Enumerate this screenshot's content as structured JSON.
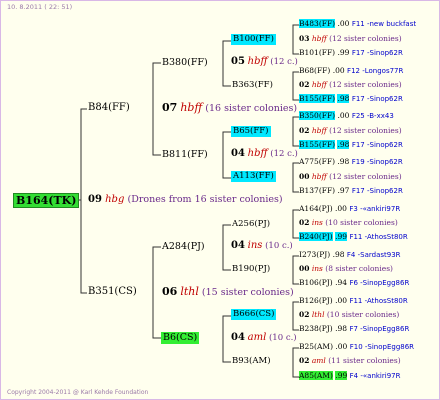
{
  "colors": {
    "root_bg": "#33dd33",
    "cyan_bg": "#00e8ff",
    "green_bg": "#33ee33",
    "red": "#c00000",
    "blue": "#0000cc"
  },
  "header": "10.  8.2011 ( 22: 51)",
  "footer": "Copyright 2004-2011 @ Karl Kehde Foundation",
  "g1": {
    "name": "B164(TK)"
  },
  "g2": [
    {
      "name": "B84(FF)",
      "year": "09",
      "code": "hbg",
      "note": "(Drones from 16 sister colonies)"
    },
    {
      "name": "B351(CS)"
    }
  ],
  "g3": [
    {
      "name": "B380(FF)",
      "year": "07",
      "code": "hbff",
      "note": "(16 sister colonies)"
    },
    {
      "name": "B811(FF)"
    },
    {
      "name": "A284(PJ)",
      "year": "06",
      "code": "lthl",
      "note": "(15 sister colonies)"
    },
    {
      "name": "B6(CS)"
    }
  ],
  "g4": [
    {
      "name": "B100(FF)",
      "year": "05",
      "code": "hbff",
      "note": "(12 c.)"
    },
    {
      "name": "B363(FF)"
    },
    {
      "name": "B65(FF)",
      "year": "04",
      "code": "hbff",
      "note": "(12 c.)"
    },
    {
      "name": "A113(FF)"
    },
    {
      "name": "A256(PJ)",
      "year": "04",
      "code": "ins",
      "note": "(10 c.)"
    },
    {
      "name": "B190(PJ)"
    },
    {
      "name": "B666(CS)",
      "year": "04",
      "code": "aml",
      "note": "(10 c.)"
    },
    {
      "name": "B93(AM)"
    }
  ],
  "g5": [
    {
      "name": "B483(FF)",
      "year": ".00",
      "right": "F11 -new buckfast"
    },
    {
      "name": "03",
      "code": "hbff",
      "note": "(12 sister colonies)"
    },
    {
      "name": "B101(FF)",
      "year": ".99",
      "right": "F17 -Sinop62R"
    },
    {
      "name": "B68(FF)",
      "year": ".00",
      "right": "F12 -Longos77R"
    },
    {
      "name": "02",
      "code": "hbff",
      "note": "(12 sister colonies)"
    },
    {
      "name": "B155(FF)",
      "year": ".98",
      "right": "F17 -Sinop62R"
    },
    {
      "name": "B350(FF)",
      "year": ".00",
      "right": "F25 -B-xx43"
    },
    {
      "name": "02",
      "code": "hbff",
      "note": "(12 sister colonies)"
    },
    {
      "name": "B155(FF)",
      "year": ".98",
      "right": "F17 -Sinop62R"
    },
    {
      "name": "A775(FF)",
      "year": ".98",
      "right": "F19 -Sinop62R"
    },
    {
      "name": "00",
      "code": "hbff",
      "note": "(12 sister colonies)"
    },
    {
      "name": "B137(FF)",
      "year": ".97",
      "right": "F17 -Sinop62R"
    },
    {
      "name": "A164(PJ)",
      "year": ".00",
      "right": "F3 -«ankiri97R"
    },
    {
      "name": "02",
      "code": "ins",
      "note": "(10 sister colonies)"
    },
    {
      "name": "B240(PJ)",
      "year": ".99",
      "right": "F11 -AthosSt80R"
    },
    {
      "name": "I273(PJ)",
      "year": ".98",
      "right": "F4 -Sardast93R"
    },
    {
      "name": "00",
      "code": "ins",
      "note": "(8 sister colonies)"
    },
    {
      "name": "B106(PJ)",
      "year": ".94",
      "right": "F6 -SinopEgg86R"
    },
    {
      "name": "B126(PJ)",
      "year": ".00",
      "right": "F11 -AthosSt80R"
    },
    {
      "name": "02",
      "code": "lthl",
      "note": "(10 sister colonies)"
    },
    {
      "name": "B238(PJ)",
      "year": ".98",
      "right": "F7 -SinopEgg86R"
    },
    {
      "name": "B25(AM)",
      "year": ".00",
      "right": "F10 -SinopEgg86R"
    },
    {
      "name": "02",
      "code": "aml",
      "note": "(11 sister colonies)"
    },
    {
      "name": "A85(AM)",
      "year": ".99",
      "right": "F4 -«ankiri97R"
    }
  ]
}
